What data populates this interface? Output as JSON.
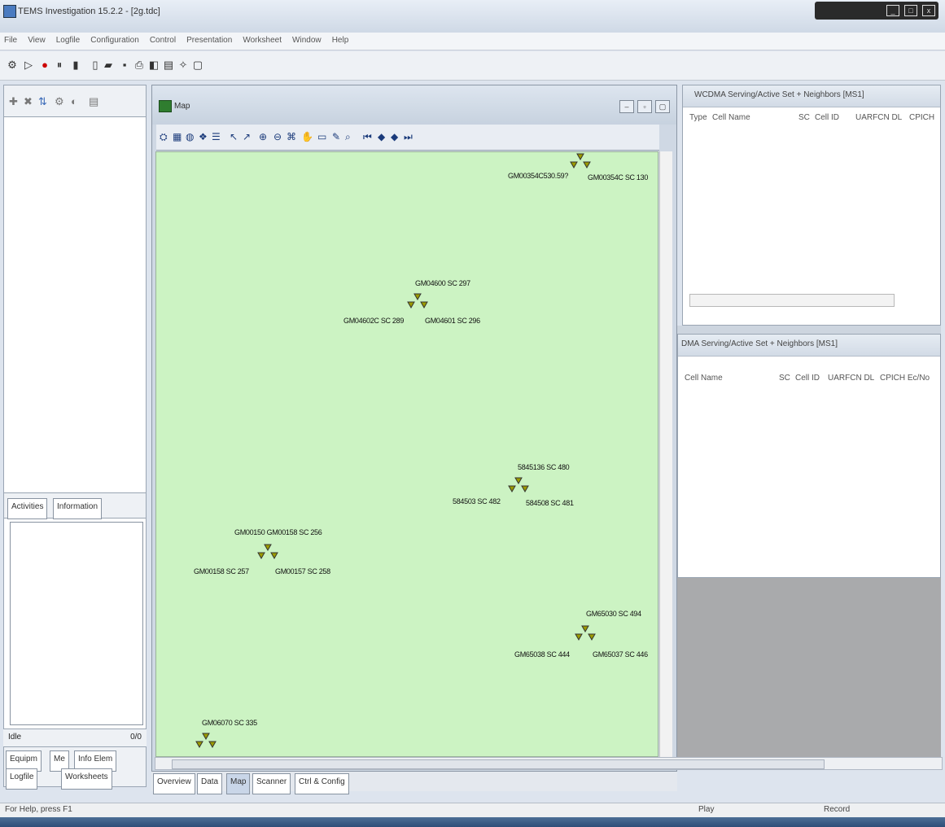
{
  "window": {
    "title": "TEMS Investigation 15.2.2 - [2g.tdc]"
  },
  "menu": [
    "File",
    "View",
    "Logfile",
    "Configuration",
    "Control",
    "Presentation",
    "Worksheet",
    "Window",
    "Help"
  ],
  "map": {
    "title": "Map",
    "sites": [
      {
        "labels": [
          "GM00354C530.59?",
          "GM00354C SC 130"
        ]
      },
      {
        "labels": [
          "GM04600 SC 297",
          "GM04602C SC 289",
          "GM04601 SC 296"
        ]
      },
      {
        "labels": [
          "5845136 SC 480",
          "584503 SC 482",
          "584508 SC 481"
        ]
      },
      {
        "labels": [
          "GM00150 GM00158 SC 256",
          "GM00158 SC 257",
          "GM00157 SC 258"
        ]
      },
      {
        "labels": [
          "GM65030 SC 494",
          "GM65038 SC 444",
          "GM65037 SC 446"
        ]
      },
      {
        "labels": [
          "GM06070 SC 335"
        ]
      }
    ],
    "tabs": [
      "Overview",
      "Data",
      "Map",
      "Scanner",
      "Ctrl & Config"
    ]
  },
  "panel1": {
    "title": "WCDMA Serving/Active Set + Neighbors [MS1]",
    "columns": [
      "Type",
      "Cell Name",
      "SC",
      "Cell ID",
      "UARFCN DL",
      "CPICH"
    ]
  },
  "panel2": {
    "title": "DMA Serving/Active Set + Neighbors [MS1]",
    "columns": [
      "Cell Name",
      "SC",
      "Cell ID",
      "UARFCN DL",
      "CPICH Ec/No"
    ]
  },
  "left": {
    "tabs_top": [
      "Activities",
      "Information"
    ],
    "idle_left": "Idle",
    "idle_right": "0/0",
    "tabs_bottom_row1": [
      "Equipm",
      "Me",
      "Info Elem"
    ],
    "tabs_bottom_row2": [
      "Logfile",
      "Worksheets"
    ]
  },
  "status": {
    "help": "For Help, press F1",
    "play": "Play",
    "record": "Record"
  }
}
